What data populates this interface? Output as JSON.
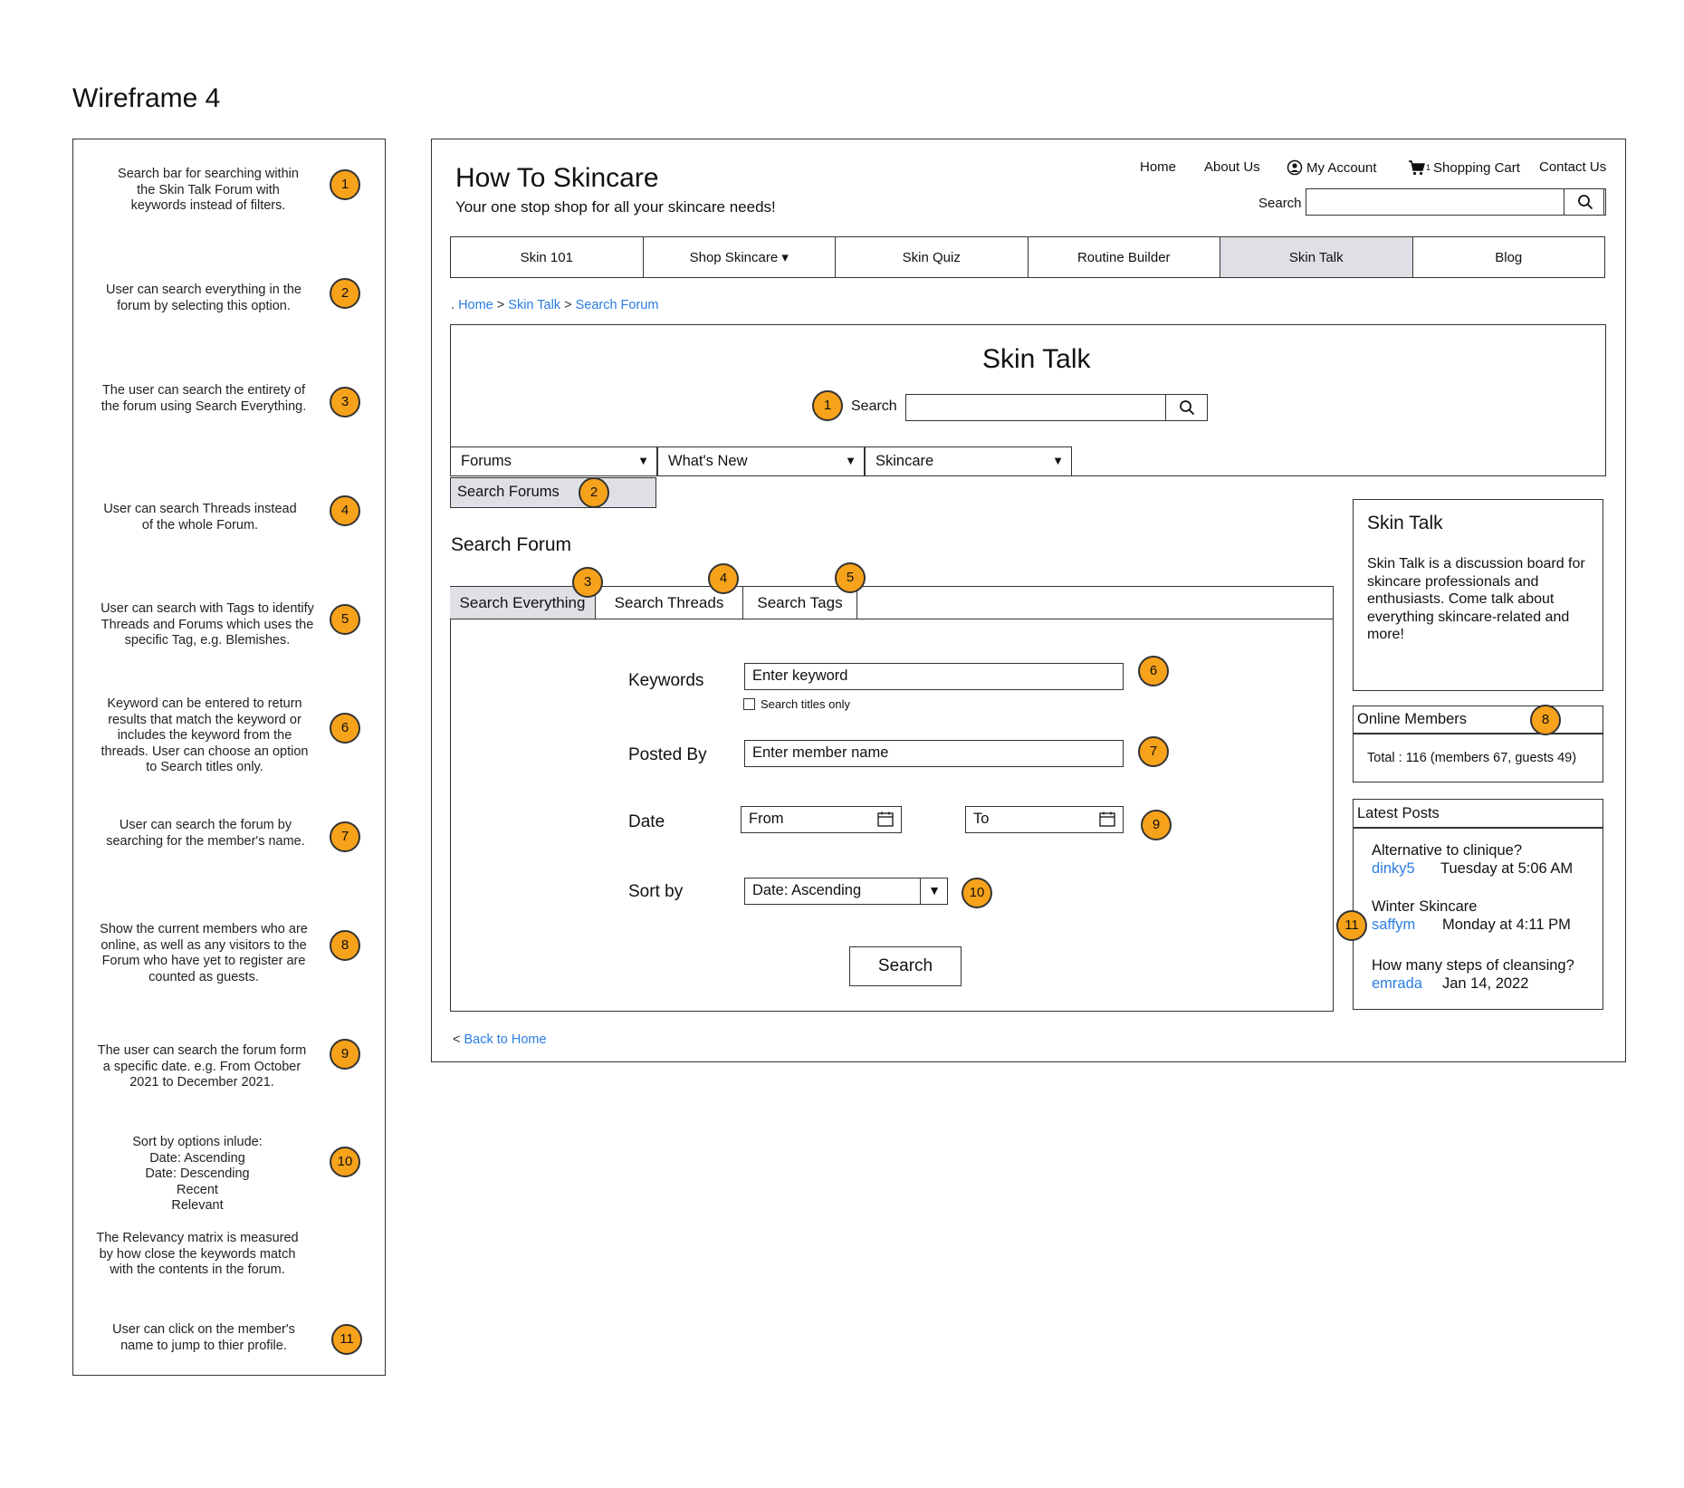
{
  "page_title": "Wireframe 4",
  "notes": [
    {
      "number": "1",
      "text": "Search bar for searching within\nthe Skin Talk Forum with\nkeywords instead of filters."
    },
    {
      "number": "2",
      "text": "User can search everything in the\nforum by selecting this option."
    },
    {
      "number": "3",
      "text": "The user can search the entirety of\nthe forum using Search Everything."
    },
    {
      "number": "4",
      "text": "User can search Threads instead\nof the whole Forum."
    },
    {
      "number": "5",
      "text": "User can search with Tags to identify\nThreads and Forums which uses the\nspecific Tag, e.g. Blemishes."
    },
    {
      "number": "6",
      "text": "Keyword can be entered to return\nresults that match the keyword or\nincludes the keyword from the\nthreads. User can choose an option\nto Search titles only."
    },
    {
      "number": "7",
      "text": "User can search the forum by\nsearching for the member's name."
    },
    {
      "number": "8",
      "text": "Show the current members who are\nonline, as well as any visitors to the\nForum who have yet to register are\ncounted as guests."
    },
    {
      "number": "9",
      "text": "The user can search the forum form\na specific date. e.g. From October\n2021 to December 2021."
    },
    {
      "number": "10",
      "text": "Sort by options inlude:\nDate: Ascending\nDate: Descending\nRecent\nRelevant"
    },
    {
      "number": "11",
      "text": "User can click on the member's\nname to jump to thier profile."
    }
  ],
  "relevancy_note": "The Relevancy matrix is measured\nby how close the keywords match\nwith the contents in the forum.",
  "site": {
    "title": "How To Skincare",
    "tagline": "Your one stop shop for all your skincare needs!"
  },
  "top_nav": {
    "home": "Home",
    "about": "About Us",
    "account": "My Account",
    "cart": "Shopping Cart",
    "cart_count": "1",
    "contact": "Contact Us",
    "search_label": "Search"
  },
  "main_nav": [
    "Skin 101",
    "Shop Skincare ▾",
    "Skin Quiz",
    "Routine Builder",
    "Skin Talk",
    "Blog"
  ],
  "breadcrumb": {
    "prefix": ".",
    "home": "Home",
    "sep": ">",
    "skin_talk": "Skin Talk",
    "current": "Search Forum"
  },
  "hero": {
    "title": "Skin Talk",
    "search_label": "Search"
  },
  "dropdowns": [
    "Forums",
    "What's New",
    "Skincare"
  ],
  "search_forums": "Search Forums",
  "search_forum_title": "Search Forum",
  "tabs": [
    "Search Everything",
    "Search Threads",
    "Search Tags"
  ],
  "form": {
    "keywords_label": "Keywords",
    "keywords_placeholder": "Enter keyword",
    "titles_only": "Search  titles only",
    "posted_by_label": "Posted By",
    "posted_by_placeholder": "Enter member name",
    "date_label": "Date",
    "from": "From",
    "to": "To",
    "sort_label": "Sort by",
    "sort_value": "Date: Ascending",
    "submit": "Search"
  },
  "back_link": {
    "prefix": "<",
    "text": "Back to Home"
  },
  "about_panel": {
    "title": "Skin Talk",
    "body": "Skin Talk is a discussion board for skincare professionals and enthusiasts. Come talk about everything skincare-related and more!"
  },
  "online_members": {
    "title": "Online Members",
    "total": "Total : 116 (members 67, guests 49)"
  },
  "latest_posts": {
    "title": "Latest Posts",
    "posts": [
      {
        "title": "Alternative to clinique?",
        "author": "dinky5",
        "time": "Tuesday at 5:06 AM"
      },
      {
        "title": "Winter Skincare",
        "author": "saffym",
        "time": "Monday at 4:11 PM"
      },
      {
        "title": "How many steps of cleansing?",
        "author": "emrada",
        "time": "Jan 14, 2022"
      }
    ]
  },
  "colors": {
    "badge": "#f7a21b",
    "link": "#2a7de1",
    "active_tab": "#dfe0e6"
  }
}
